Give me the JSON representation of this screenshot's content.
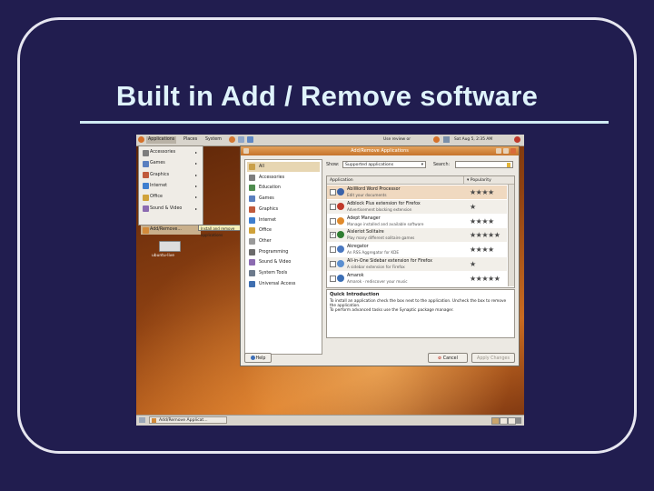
{
  "slide": {
    "title": "Built in Add / Remove software"
  },
  "panel": {
    "menus": [
      "Applications",
      "Places",
      "System"
    ],
    "tray_text": "Use review or",
    "clock": "Sat Aug 5, 2:35 AM"
  },
  "apps_menu": {
    "items": [
      {
        "label": "Accessories",
        "color": "#7d7d7d"
      },
      {
        "label": "Games",
        "color": "#5a7fbf"
      },
      {
        "label": "Graphics",
        "color": "#c05a3c"
      },
      {
        "label": "Internet",
        "color": "#3f7fcf"
      },
      {
        "label": "Office",
        "color": "#d0a23a"
      },
      {
        "label": "Sound & Video",
        "color": "#8c6bb1"
      }
    ],
    "add_remove": "Add/Remove...",
    "tooltip": "Install and remove applications"
  },
  "desktop": {
    "drive_label": "ubuntu-live"
  },
  "taskbar": {
    "window_button": "Add/Remove Applicat..."
  },
  "dialog": {
    "title": "Add/Remove Applications",
    "categories": [
      {
        "label": "All",
        "color": "#c9a04a"
      },
      {
        "label": "Accessories",
        "color": "#7d7d7d"
      },
      {
        "label": "Education",
        "color": "#4f8c4f"
      },
      {
        "label": "Games",
        "color": "#5a7fbf"
      },
      {
        "label": "Graphics",
        "color": "#c05a3c"
      },
      {
        "label": "Internet",
        "color": "#3f7fcf"
      },
      {
        "label": "Office",
        "color": "#d0a23a"
      },
      {
        "label": "Other",
        "color": "#9a9a9a"
      },
      {
        "label": "Programming",
        "color": "#6b6b6b"
      },
      {
        "label": "Sound & Video",
        "color": "#8c6bb1"
      },
      {
        "label": "System Tools",
        "color": "#6c7a8c"
      },
      {
        "label": "Universal Access",
        "color": "#3f6fb0"
      }
    ],
    "show_label": "Show:",
    "show_value": "Supported applications",
    "search_label": "Search:",
    "search_value": "",
    "col_application": "Application",
    "col_popularity": "Popularity",
    "apps": [
      {
        "name": "AbiWord Word Processor",
        "desc": "Edit your documents",
        "stars": "★★★★",
        "checked": "",
        "icon": "#3b62a8"
      },
      {
        "name": "Adblock Plus extension for Firefox",
        "desc": "Advertisement blocking extension",
        "stars": "★",
        "checked": "",
        "icon": "#c0392b"
      },
      {
        "name": "Adept Manager",
        "desc": "Manage installed and available software",
        "stars": "★★★★",
        "checked": "",
        "icon": "#e08a2c"
      },
      {
        "name": "Aisleriot Solitaire",
        "desc": "Play many different solitaire games",
        "stars": "★★★★★",
        "checked": "✓",
        "icon": "#2f7d32"
      },
      {
        "name": "Akregator",
        "desc": "An RSS Aggregator for KDE",
        "stars": "★★★★",
        "checked": "",
        "icon": "#4a78c0"
      },
      {
        "name": "All-in-One Sidebar extension for Firefox",
        "desc": "A sidebar extension for Firefox",
        "stars": "★",
        "checked": "",
        "icon": "#5b8fd0"
      },
      {
        "name": "Amarok",
        "desc": "Amarok - rediscover your music",
        "stars": "★★★★★",
        "checked": "",
        "icon": "#3c6fb5"
      }
    ],
    "intro_title": "Quick Introduction",
    "intro_text": "To install an application check the box next to the application. Uncheck the box to remove the application.",
    "intro_text2": "To perform advanced tasks use the Synaptic package manager.",
    "help": "Help",
    "cancel": "Cancel",
    "apply": "Apply Changes"
  }
}
